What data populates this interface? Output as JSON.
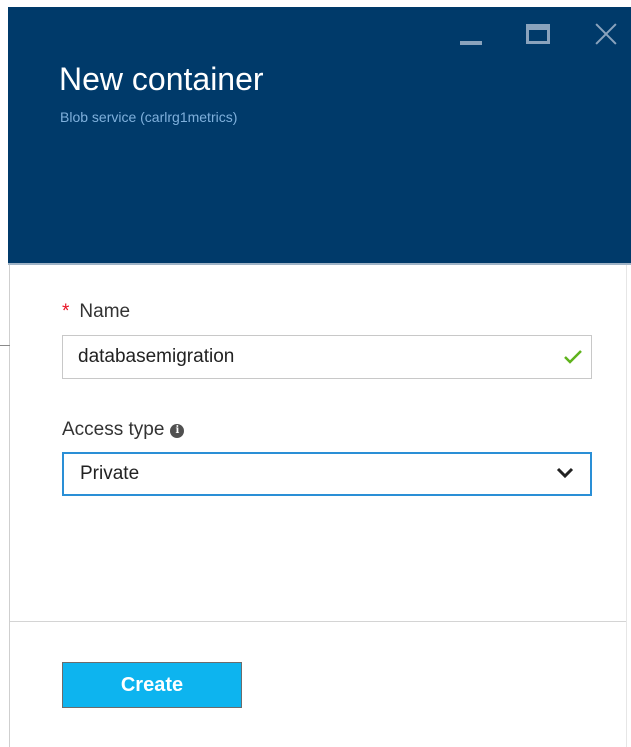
{
  "blade": {
    "title": "New container",
    "subtitle": "Blob service (carlrg1metrics)",
    "window_controls": {
      "minimize_icon": "minimize-icon",
      "maximize_icon": "maximize-icon",
      "close_icon": "close-icon"
    }
  },
  "form": {
    "name": {
      "required_mark": "*",
      "label": "Name",
      "value": "databasemigration",
      "validation_icon": "check-icon"
    },
    "access_type": {
      "label": "Access type",
      "info_icon": "info-icon",
      "info_glyph": "i",
      "selected": "Private",
      "dropdown_icon": "chevron-down-icon"
    }
  },
  "footer": {
    "create_label": "Create"
  },
  "colors": {
    "header_bg": "#003a6a",
    "subtitle": "#7fb0dc",
    "accent_button": "#0db4ef",
    "focus_border": "#2a8fd6",
    "required": "#e81123",
    "valid_check": "#5fb31c"
  }
}
